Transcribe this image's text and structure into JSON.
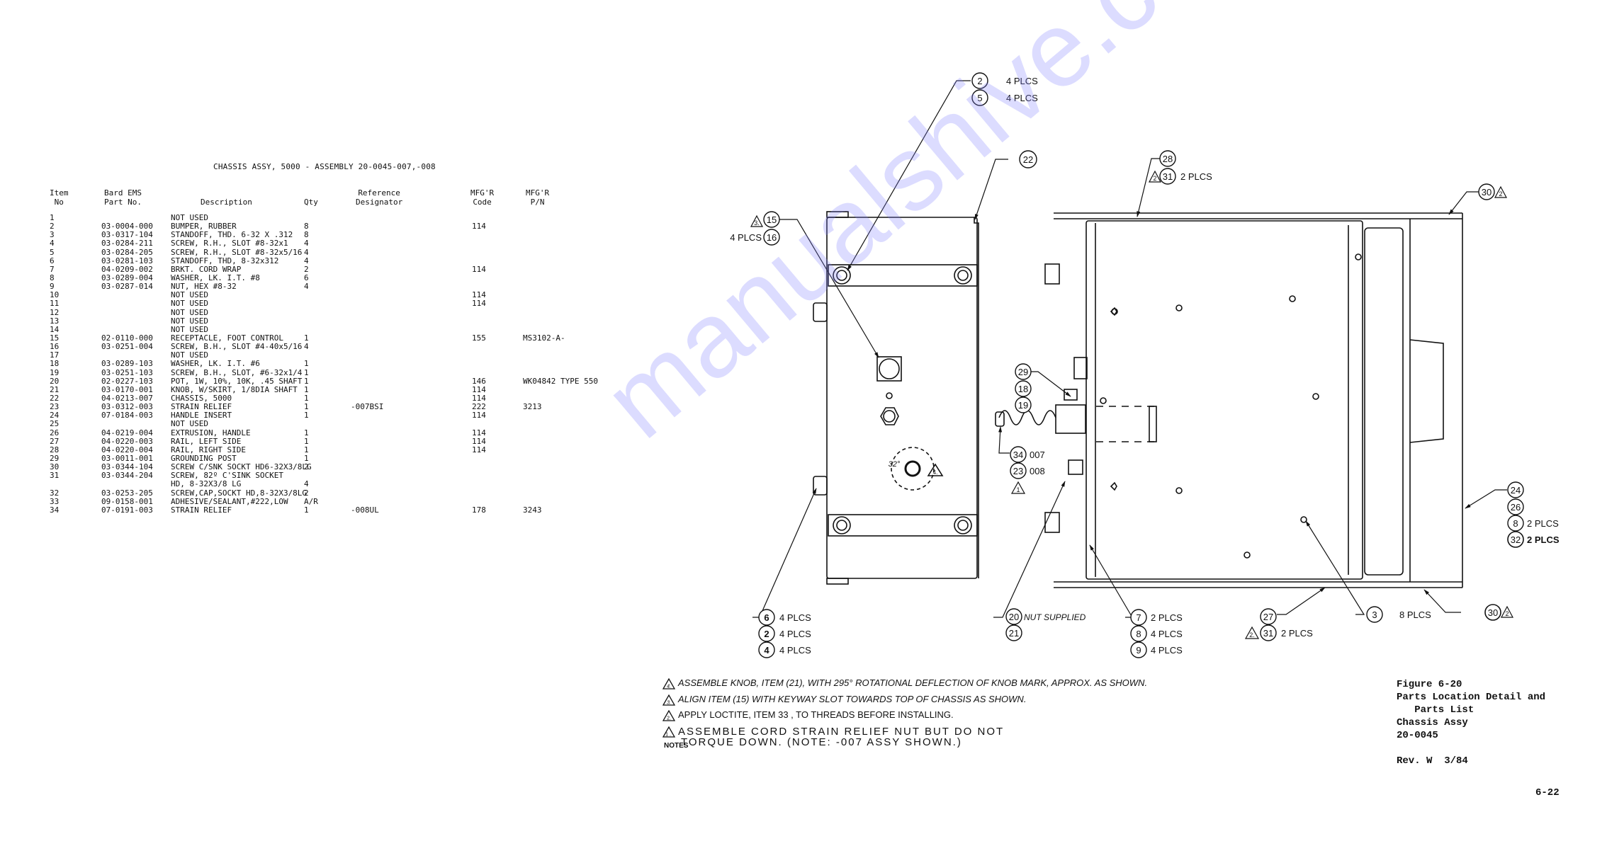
{
  "parts_list": {
    "title": "CHASSIS ASSY, 5000 - ASSEMBLY 20-0045-007,-008",
    "headers": {
      "item": "Item\nNo",
      "part": "Bard EMS\nPart No.",
      "desc": "Description",
      "qty": "Qty",
      "ref": "Reference\nDesignator",
      "code": "MFG'R\nCode",
      "pn": "MFG'R\nP/N"
    },
    "rows": [
      {
        "item": "1",
        "part": "",
        "desc": "NOT USED",
        "qty": "",
        "ref": "",
        "code": "",
        "pn": ""
      },
      {
        "item": "2",
        "part": "03-0004-000",
        "desc": "BUMPER, RUBBER",
        "qty": "8",
        "ref": "",
        "code": "114",
        "pn": ""
      },
      {
        "item": "3",
        "part": "03-0317-104",
        "desc": "STANDOFF, THD. 6-32 X .312",
        "qty": "8",
        "ref": "",
        "code": "",
        "pn": ""
      },
      {
        "item": "4",
        "part": "03-0284-211",
        "desc": "SCREW, R.H., SLOT #8-32x1",
        "qty": "4",
        "ref": "",
        "code": "",
        "pn": ""
      },
      {
        "item": "5",
        "part": "03-0284-205",
        "desc": "SCREW, R.H., SLOT #8-32x5/16",
        "qty": "4",
        "ref": "",
        "code": "",
        "pn": ""
      },
      {
        "item": "6",
        "part": "03-0281-103",
        "desc": "STANDOFF, THD, 8-32x312",
        "qty": "4",
        "ref": "",
        "code": "",
        "pn": ""
      },
      {
        "item": "7",
        "part": "04-0209-002",
        "desc": "BRKT. CORD WRAP",
        "qty": "2",
        "ref": "",
        "code": "114",
        "pn": ""
      },
      {
        "item": "8",
        "part": "03-0289-004",
        "desc": "WASHER, LK. I.T. #8",
        "qty": "6",
        "ref": "",
        "code": "",
        "pn": ""
      },
      {
        "item": "9",
        "part": "03-0287-014",
        "desc": "NUT, HEX #8-32",
        "qty": "4",
        "ref": "",
        "code": "",
        "pn": ""
      },
      {
        "item": "10",
        "part": "",
        "desc": "NOT USED",
        "qty": "",
        "ref": "",
        "code": "114",
        "pn": ""
      },
      {
        "item": "11",
        "part": "",
        "desc": "NOT USED",
        "qty": "",
        "ref": "",
        "code": "114",
        "pn": ""
      },
      {
        "item": "12",
        "part": "",
        "desc": "NOT USED",
        "qty": "",
        "ref": "",
        "code": "",
        "pn": ""
      },
      {
        "item": "13",
        "part": "",
        "desc": "NOT USED",
        "qty": "",
        "ref": "",
        "code": "",
        "pn": ""
      },
      {
        "item": "14",
        "part": "",
        "desc": "NOT USED",
        "qty": "",
        "ref": "",
        "code": "",
        "pn": ""
      },
      {
        "item": "15",
        "part": "02-0110-000",
        "desc": "RECEPTACLE, FOOT CONTROL",
        "qty": "1",
        "ref": "",
        "code": "155",
        "pn": "MS3102-A-"
      },
      {
        "item": "16",
        "part": "03-0251-004",
        "desc": "SCREW, B.H., SLOT #4-40x5/16",
        "qty": "4",
        "ref": "",
        "code": "",
        "pn": ""
      },
      {
        "item": "17",
        "part": "",
        "desc": "NOT USED",
        "qty": "",
        "ref": "",
        "code": "",
        "pn": ""
      },
      {
        "item": "18",
        "part": "03-0289-103",
        "desc": "WASHER, LK. I.T. #6",
        "qty": "1",
        "ref": "",
        "code": "",
        "pn": ""
      },
      {
        "item": "19",
        "part": "03-0251-103",
        "desc": "SCREW, B.H., SLOT, #6-32x1/4",
        "qty": "1",
        "ref": "",
        "code": "",
        "pn": ""
      },
      {
        "item": "20",
        "part": "02-0227-103",
        "desc": "POT, 1W, 10%, 10K, .45 SHAFT",
        "qty": "1",
        "ref": "",
        "code": "146",
        "pn": "WK04842 TYPE 550"
      },
      {
        "item": "21",
        "part": "03-0170-001",
        "desc": "KNOB, W/SKIRT, 1/8DIA SHAFT",
        "qty": "1",
        "ref": "",
        "code": "114",
        "pn": ""
      },
      {
        "item": "22",
        "part": "04-0213-007",
        "desc": "CHASSIS, 5000",
        "qty": "1",
        "ref": "",
        "code": "114",
        "pn": ""
      },
      {
        "item": "23",
        "part": "03-0312-003",
        "desc": "STRAIN RELIEF",
        "qty": "1",
        "ref": "-007BSI",
        "code": "222",
        "pn": "3213"
      },
      {
        "item": "24",
        "part": "07-0184-003",
        "desc": "HANDLE INSERT",
        "qty": "1",
        "ref": "",
        "code": "114",
        "pn": ""
      },
      {
        "item": "25",
        "part": "",
        "desc": "NOT USED",
        "qty": "",
        "ref": "",
        "code": "",
        "pn": ""
      },
      {
        "item": "26",
        "part": "04-0219-004",
        "desc": "EXTRUSION, HANDLE",
        "qty": "1",
        "ref": "",
        "code": "114",
        "pn": ""
      },
      {
        "item": "27",
        "part": "04-0220-003",
        "desc": "RAIL, LEFT SIDE",
        "qty": "1",
        "ref": "",
        "code": "114",
        "pn": ""
      },
      {
        "item": "28",
        "part": "04-0220-004",
        "desc": "RAIL, RIGHT SIDE",
        "qty": "1",
        "ref": "",
        "code": "114",
        "pn": ""
      },
      {
        "item": "29",
        "part": "03-0011-001",
        "desc": "GROUNDING POST",
        "qty": "1",
        "ref": "",
        "code": "",
        "pn": ""
      },
      {
        "item": "30",
        "part": "03-0344-104",
        "desc": "SCREW C/SNK SOCKT HD6-32X3/8LG",
        "qty": "2",
        "ref": "",
        "code": "",
        "pn": ""
      },
      {
        "item": "31",
        "part": "03-0344-204",
        "desc": "SCREW, 82º C'SINK SOCKET",
        "qty": "",
        "ref": "",
        "code": "",
        "pn": ""
      },
      {
        "item": "",
        "part": "",
        "desc": "HD, 8-32X3/8 LG",
        "qty": "4",
        "ref": "",
        "code": "",
        "pn": ""
      },
      {
        "item": "32",
        "part": "03-0253-205",
        "desc": "SCREW,CAP,SOCKT HD,8-32X3/8LG",
        "qty": "2",
        "ref": "",
        "code": "",
        "pn": ""
      },
      {
        "item": "33",
        "part": "09-0158-001",
        "desc": "ADHESIVE/SEALANT,#222,LOW",
        "qty": "A/R",
        "ref": "",
        "code": "",
        "pn": ""
      },
      {
        "item": "34",
        "part": "07-0191-003",
        "desc": "STRAIN RELIEF",
        "qty": "1",
        "ref": "-008UL",
        "code": "178",
        "pn": "3243"
      }
    ]
  },
  "drawing": {
    "callouts": {
      "c2_top": "2",
      "c2_top_note": "4 PLCS",
      "c5_top": "5",
      "c5_top_note": "4 PLCS",
      "c22": "22",
      "c15": "15",
      "c15_flag": "3.",
      "c16": "16",
      "c16_note": "4 PLCS",
      "c28": "28",
      "c31_top": "31",
      "c31_top_flag": "2",
      "c31_top_note": "2 PLCS",
      "c30_top": "30",
      "c30_top_flag": "2",
      "c29": "29",
      "c18": "18",
      "c19": "19",
      "c34": "34",
      "c34_note": "007",
      "c23": "23",
      "c23_note": "008",
      "c23_flag": "1",
      "c24": "24",
      "c26": "26",
      "c8_right": "8",
      "c8_right_note": "2 PLCS",
      "c32": "32",
      "c32_note": "2 PLCS",
      "c6": "6",
      "c6_note": "4 PLCS",
      "c2_bot": "2",
      "c2_bot_note": "4 PLCS",
      "c4": "4",
      "c4_note": "4 PLCS",
      "c20": "20",
      "c20_note": "NUT SUPPLIED",
      "c21": "21",
      "c7": "7",
      "c7_note": "2 PLCS",
      "c8_bot": "8",
      "c8_bot_note": "4 PLCS",
      "c9": "9",
      "c9_note": "4 PLCS",
      "c27": "27",
      "c31_bot": "31",
      "c31_bot_flag": "2.",
      "c31_bot_note": "2 PLCS",
      "c3": "3",
      "c3_note": "8 PLCS",
      "c30_bot": "30",
      "c30_bot_flag": "2",
      "angle": "32°",
      "knob_flag": "4."
    }
  },
  "notes": {
    "items": [
      {
        "flag": "4.",
        "text": "ASSEMBLE KNOB, ITEM (21), WITH 295° ROTATIONAL DEFLECTION OF KNOB MARK, APPROX. AS SHOWN."
      },
      {
        "flag": "3.",
        "text": "ALIGN ITEM (15) WITH KEYWAY SLOT TOWARDS TOP OF CHASSIS AS SHOWN."
      },
      {
        "flag": "2.",
        "text": "APPLY LOCTITE, ITEM 33 , TO THREADS BEFORE INSTALLING."
      },
      {
        "flag": "1.",
        "text": "ASSEMBLE CORD STRAIN RELIEF NUT BUT DO NOT"
      },
      {
        "flag": "",
        "text": "TORQUE DOWN. (NOTE: -007 ASSY SHOWN.)"
      }
    ],
    "label": "NOTES"
  },
  "figure": {
    "caption": "Figure 6-20\nParts Location Detail and\n   Parts List\nChassis Assy\n20-0045\n\nRev. W  3/84",
    "page_number": "6-22"
  },
  "watermark": "manualshive.com"
}
